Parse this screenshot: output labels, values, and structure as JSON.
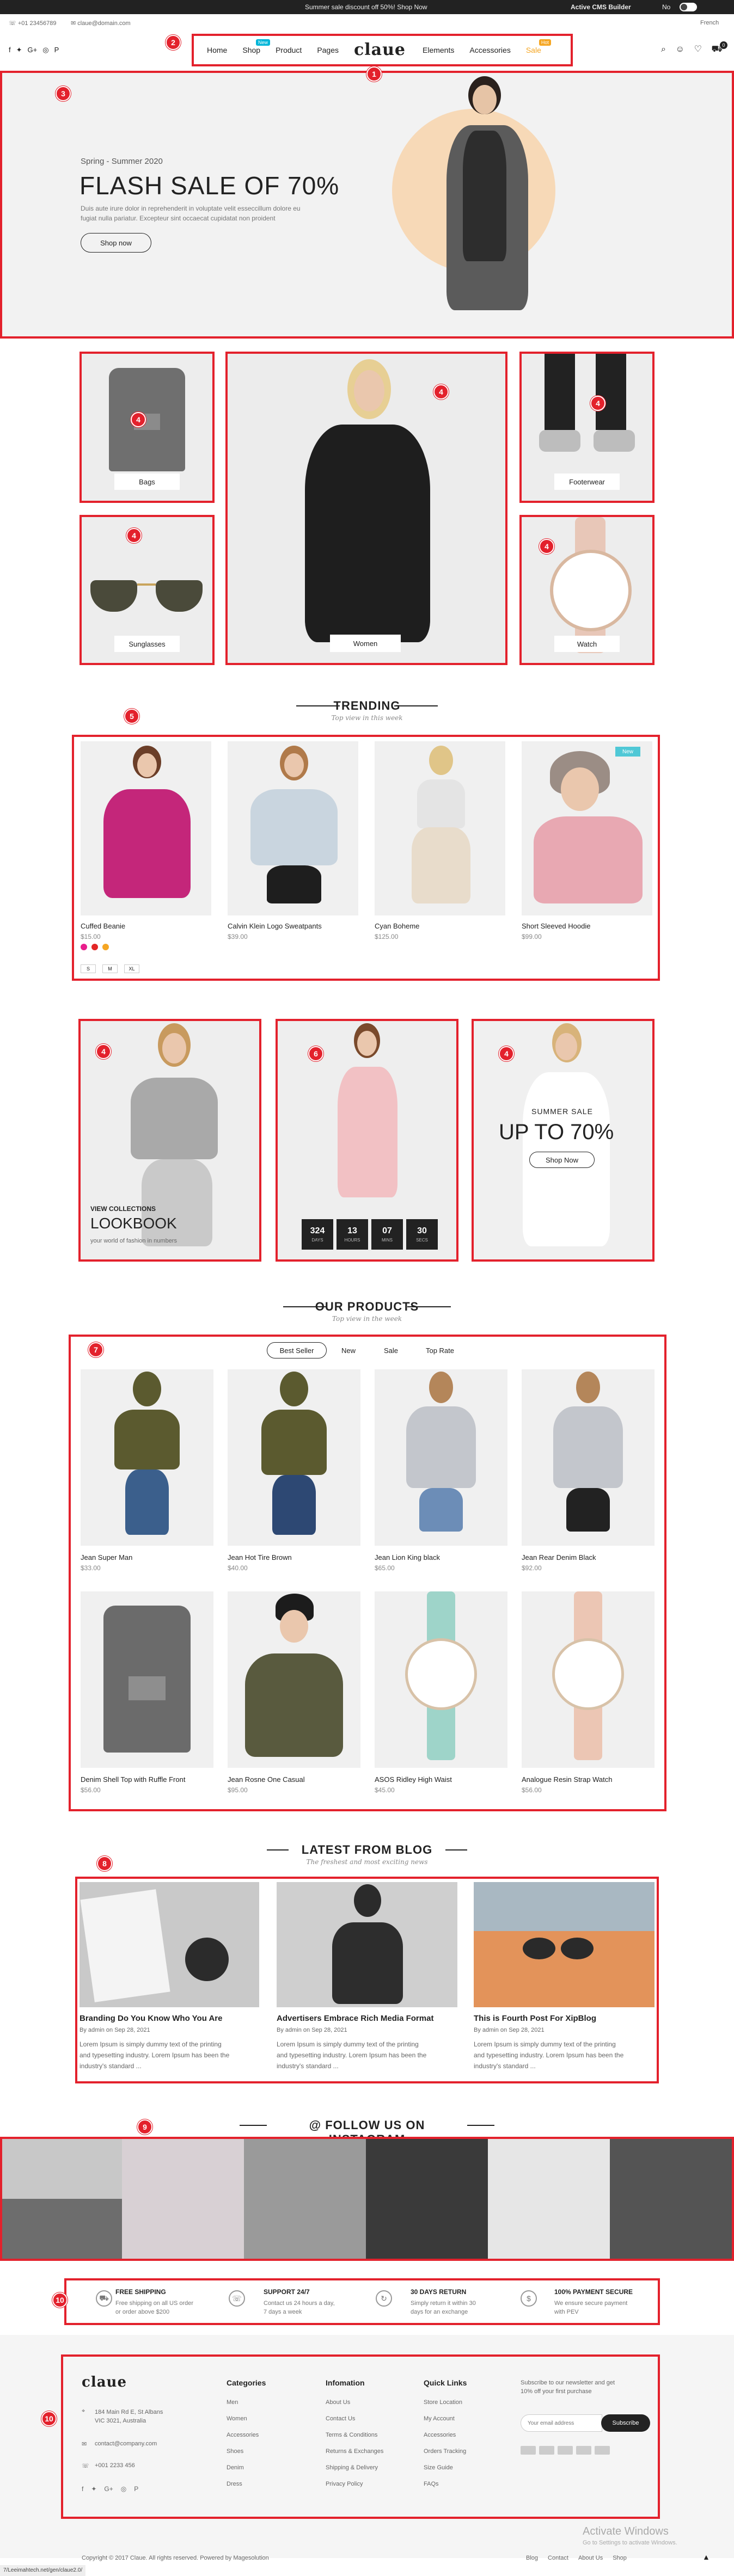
{
  "topbar": {
    "promo": "Summer sale discount off 50%! Shop Now",
    "cms": "Active CMS Builder",
    "toggle": "No",
    "language": "French"
  },
  "header": {
    "phone": "+01 23456789",
    "email": "claue@domain.com",
    "logo": "claue",
    "social_icons": [
      "facebook-icon",
      "twitter-icon",
      "google-plus-icon",
      "instagram-icon",
      "pinterest-icon"
    ],
    "nav_left": [
      {
        "label": "Home"
      },
      {
        "label": "Shop",
        "badge": "New",
        "badge_color": "#00b5d8"
      },
      {
        "label": "Product"
      },
      {
        "label": "Pages"
      }
    ],
    "nav_right": [
      {
        "label": "Elements"
      },
      {
        "label": "Accessories"
      },
      {
        "label": "Sale",
        "badge": "Hot",
        "badge_color": "#f5a623",
        "color": "#f5a623"
      }
    ],
    "cart_count": "0"
  },
  "annotations": [
    "1",
    "2",
    "3",
    "4",
    "5",
    "6",
    "7",
    "8",
    "9",
    "10"
  ],
  "hero": {
    "subtitle": "Spring - Summer 2020",
    "title": "FLASH SALE OF 70%",
    "text1": "Duis aute irure dolor in reprehenderit in voluptate velit esseccillum dolore eu",
    "text2": "fugiat nulla pariatur. Excepteur sint occaecat cupidatat non proident",
    "button": "Shop now"
  },
  "categories": {
    "bags": "Bags",
    "women": "Women",
    "footwear": "Footerwear",
    "sunglasses": "Sunglasses",
    "watch": "Watch"
  },
  "trending": {
    "title": "TRENDING",
    "subtitle": "Top view in this week",
    "products": [
      {
        "name": "Cuffed Beanie",
        "price": "$15.00"
      },
      {
        "name": "Calvin Klein Logo Sweatpants",
        "price": "$39.00"
      },
      {
        "name": "Cyan Boheme",
        "price": "$125.00"
      },
      {
        "name": "Short Sleeved Hoodie",
        "price": "$99.00",
        "badge": "New"
      }
    ],
    "sizes": [
      "S",
      "M",
      "XL"
    ],
    "swatches": [
      "#e91e8c",
      "#e32626",
      "#f5a623"
    ]
  },
  "lookbook": {
    "label": "VIEW COLLECTIONS",
    "title": "LOOKBOOK",
    "text": "your world of fashion in numbers"
  },
  "countdown": [
    {
      "value": "324",
      "unit": "DAYS"
    },
    {
      "value": "13",
      "unit": "HOURS"
    },
    {
      "value": "07",
      "unit": "MINS"
    },
    {
      "value": "30",
      "unit": "SECS"
    }
  ],
  "summer_sale": {
    "label": "SUMMER SALE",
    "title": "UP TO 70%",
    "button": "Shop Now"
  },
  "our_products": {
    "title": "OUR PRODUCTS",
    "subtitle": "Top view in the week",
    "tabs": [
      "Best Seller",
      "New",
      "Sale",
      "Top Rate"
    ],
    "products": [
      {
        "name": "Jean Super Man",
        "price": "$33.00"
      },
      {
        "name": "Jean Hot Tire Brown",
        "price": "$40.00"
      },
      {
        "name": "Jean Lion King black",
        "price": "$65.00"
      },
      {
        "name": "Jean Rear Denim Black",
        "price": "$92.00"
      },
      {
        "name": "Denim Shell Top with Ruffle Front",
        "price": "$56.00"
      },
      {
        "name": "Jean Rosne One Casual",
        "price": "$95.00"
      },
      {
        "name": "ASOS Ridley High Waist",
        "price": "$45.00"
      },
      {
        "name": "Analogue Resin Strap Watch",
        "price": "$56.00"
      }
    ]
  },
  "blog": {
    "title": "LATEST FROM BLOG",
    "subtitle": "The freshest and most exciting news",
    "posts": [
      {
        "title": "Branding Do You Know Who You Are",
        "meta": "By admin on Sep 28, 2021",
        "text": [
          "Lorem Ipsum is simply dummy text of the printing",
          "and typesetting industry. Lorem Ipsum has been the",
          "industry's standard ..."
        ]
      },
      {
        "title": "Advertisers Embrace Rich Media Format",
        "meta": "By admin on Sep 28, 2021",
        "text": [
          "Lorem Ipsum is simply dummy text of the printing",
          "and typesetting industry. Lorem Ipsum has been the",
          "industry's standard ..."
        ]
      },
      {
        "title": "This is Fourth Post For XipBlog",
        "meta": "By admin on Sep 28, 2021",
        "text": [
          "Lorem Ipsum is simply dummy text of the printing",
          "and typesetting industry. Lorem Ipsum has been the",
          "industry's standard ..."
        ]
      }
    ]
  },
  "instagram": {
    "title": "@ FOLLOW US ON INSTAGRAM"
  },
  "features": [
    {
      "title": "FREE SHIPPING",
      "text": [
        "Free shipping on all US order",
        "or order above $200"
      ],
      "icon": "truck-icon"
    },
    {
      "title": "SUPPORT 24/7",
      "text": [
        "Contact us 24 hours a day,",
        "7 days a week"
      ],
      "icon": "support-icon"
    },
    {
      "title": "30 DAYS RETURN",
      "text": [
        "Simply return it within 30",
        "days for an exchange"
      ],
      "icon": "return-icon"
    },
    {
      "title": "100% PAYMENT SECURE",
      "text": [
        "We ensure secure payment",
        "with PEV"
      ],
      "icon": "secure-icon"
    }
  ],
  "footer": {
    "logo": "claue",
    "address": [
      "184 Main Rd E, St Albans",
      "VIC 3021, Australia"
    ],
    "email": "contact@company.com",
    "phone": "+001 2233 456",
    "categories_title": "Categories",
    "categories": [
      "Men",
      "Women",
      "Accessories",
      "Shoes",
      "Denim",
      "Dress"
    ],
    "information_title": "Infomation",
    "information": [
      "About Us",
      "Contact Us",
      "Terms & Conditions",
      "Returns & Exchanges",
      "Shipping & Delivery",
      "Privacy Policy"
    ],
    "quick_title": "Quick Links",
    "quick": [
      "Store Location",
      "My Account",
      "Accessories",
      "Orders Tracking",
      "Size Guide",
      "FAQs"
    ],
    "newsletter": [
      "Subscribe to our newsletter and get",
      "10% off your first purchase"
    ],
    "email_placeholder": "Your email address",
    "subscribe": "Subscribe",
    "copyright": "Copyright © 2017 Claue. All rights reserved. Powered by Magesolution",
    "bottom_links": [
      "Blog",
      "Contact",
      "About Us",
      "Shop"
    ],
    "activate": [
      "Activate Windows",
      "Go to Settings to activate Windows."
    ],
    "url": "7/Leeimahtech.net/gen/claue2.0/"
  }
}
